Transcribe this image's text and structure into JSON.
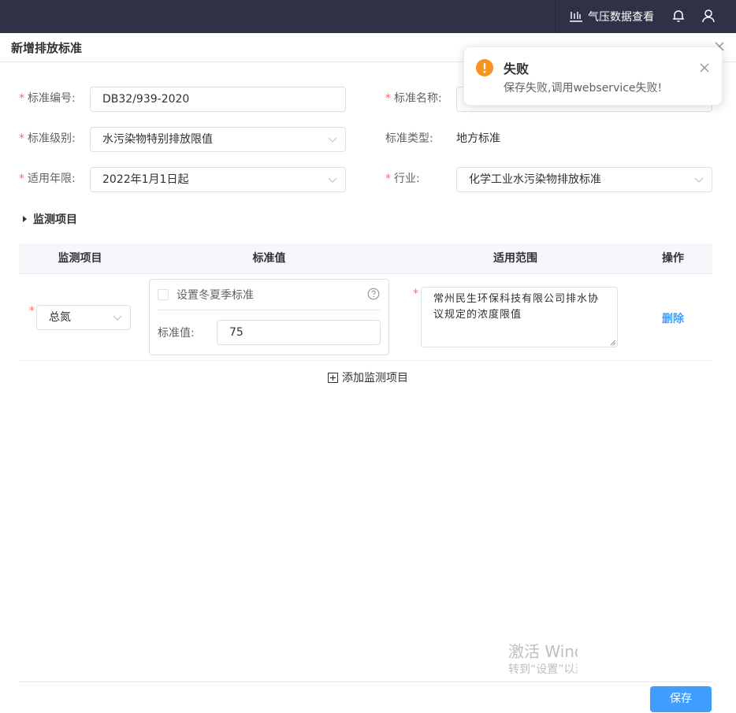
{
  "header": {
    "pressure_label": "气压数据查看",
    "pressure_icon": "pressure-chart-icon",
    "bell_icon": "bell-icon",
    "user_icon": "user-icon"
  },
  "dialog": {
    "title": "新增排放标准",
    "close_icon": "close-icon"
  },
  "form": {
    "required_mark": "*",
    "std_no_label": "标准编号:",
    "std_no_value": "DB32/939-2020",
    "std_name_label": "标准名称:",
    "std_level_label": "标准级别:",
    "std_level_value": "水污染物特别排放限值",
    "std_type_label": "标准类型:",
    "std_type_value": "地方标准",
    "year_label": "适用年限:",
    "year_value": "2022年1月1日起",
    "industry_label": "行业:",
    "industry_value": "化学工业水污染物排放标准"
  },
  "monitor": {
    "section_title": "监测项目",
    "columns": [
      "监测项目",
      "标准值",
      "适用范围",
      "操作"
    ],
    "rows": [
      {
        "item": "总氮",
        "season_checkbox_label": "设置冬夏季标准",
        "season_checked": false,
        "value_label": "标准值:",
        "value": "75",
        "scope": "常州民生环保科技有限公司排水协议规定的浓度限值",
        "action": "删除"
      }
    ],
    "add_label": "添加监测项目"
  },
  "footer": {
    "save_label": "保存"
  },
  "watermark": {
    "line1": "激活 Windows",
    "line2": "转到“设置”以激活 Windows。"
  },
  "toast": {
    "title": "失败",
    "message": "保存失败,调用webservice失败!",
    "type_color": "#f7931e"
  },
  "colors": {
    "topbar": "#2f3247",
    "primary": "#409eff",
    "required": "#f56c6c",
    "warning": "#f7931e"
  }
}
